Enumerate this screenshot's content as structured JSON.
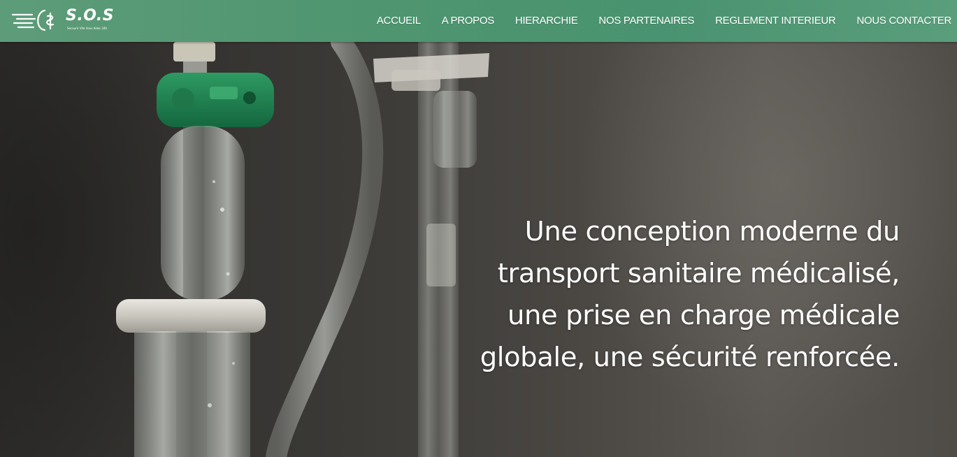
{
  "brand": {
    "name": "S.O.S",
    "tagline": "Secourir Vite Vous Aider 24h",
    "colors": {
      "navbar": "#4e9570",
      "text": "#ffffff"
    }
  },
  "nav": {
    "items": [
      {
        "label": "ACCUEIL"
      },
      {
        "label": "A PROPOS"
      },
      {
        "label": "HIERARCHIE"
      },
      {
        "label": "NOS PARTENAIRES"
      },
      {
        "label": "REGLEMENT INTERIEUR"
      },
      {
        "label": "NOUS CONTACTER"
      }
    ]
  },
  "hero": {
    "image_subject": "iv-drip-chamber",
    "headline_lines": [
      "Une conception moderne du",
      "transport sanitaire médicalisé,",
      "une prise en charge médicale",
      "globale, une sécurité renforcée."
    ]
  }
}
